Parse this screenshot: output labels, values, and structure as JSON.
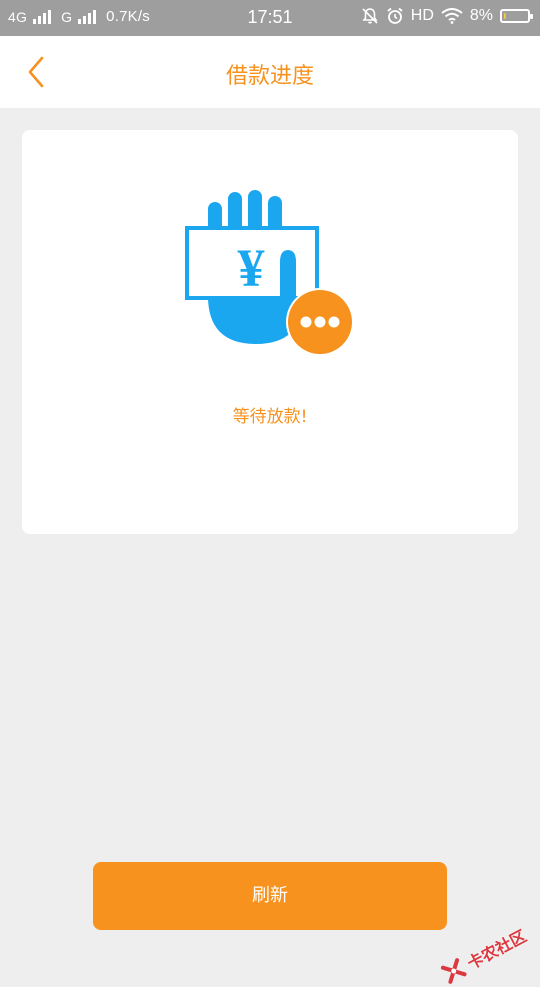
{
  "status_bar": {
    "network1": "4G",
    "network2": "G",
    "speed": "0.7K/s",
    "time": "17:51",
    "hd": "HD",
    "battery": "8%",
    "battery_level": 0.08
  },
  "nav": {
    "title": "借款进度",
    "back_icon": "chevron-left-icon"
  },
  "card": {
    "illustration_icon": "hand-money-pending-icon",
    "currency_symbol": "¥",
    "status_text": "等待放款!"
  },
  "actions": {
    "refresh_label": "刷新"
  },
  "watermark": {
    "text": "卡农社区"
  },
  "colors": {
    "accent": "#f7921e",
    "illustration_blue": "#1aa7f0",
    "background": "#eeeeee",
    "status_bar": "#9e9e9e"
  }
}
